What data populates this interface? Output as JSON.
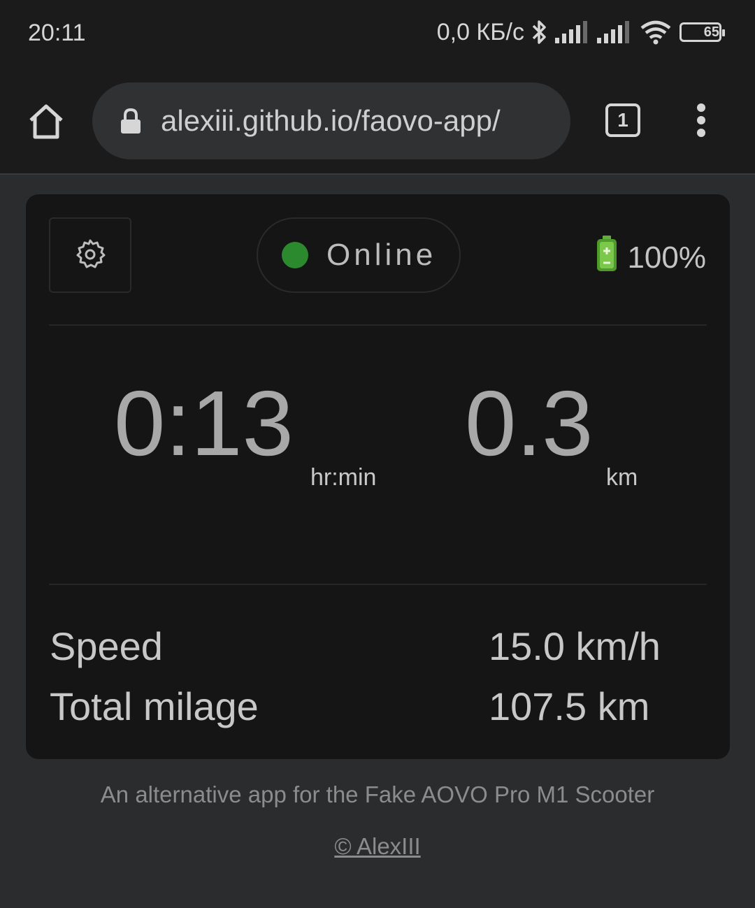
{
  "status_bar": {
    "time": "20:11",
    "network_speed": "0,0 КБ/с",
    "battery_level": "65",
    "icons": [
      "bluetooth-icon",
      "signal-icon",
      "signal-icon",
      "wifi-icon",
      "battery-icon"
    ]
  },
  "browser": {
    "url": "alexiii.github.io/faovo-app/",
    "tab_count": "1",
    "icons": [
      "home-icon",
      "lock-icon",
      "tabs-icon",
      "more-vert-icon"
    ]
  },
  "app": {
    "status": "Online",
    "status_color": "#2b8a2e",
    "battery": "100%",
    "battery_icon": "battery-icon",
    "settings_icon": "gear-icon",
    "trip_time": "0:13",
    "trip_time_unit": "hr:min",
    "trip_distance": "0.3",
    "trip_distance_unit": "km",
    "stats": [
      {
        "label": "Speed",
        "value": "15.0 km/h"
      },
      {
        "label": "Total milage",
        "value": "107.5 km"
      }
    ]
  },
  "footer": {
    "description": "An alternative app for the Fake AOVO Pro M1 Scooter",
    "credit": "© AlexIII"
  }
}
